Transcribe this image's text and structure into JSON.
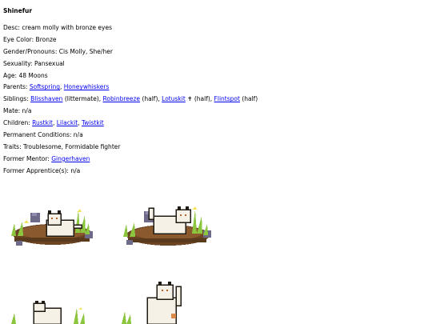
{
  "name": "Shinefur",
  "fields": {
    "desc": {
      "label": "Desc:",
      "value": "cream molly with bronze eyes"
    },
    "eye_color": {
      "label": "Eye Color:",
      "value": "Bronze"
    },
    "gender": {
      "label": "Gender/Pronouns:",
      "value": "Cis Molly, She/her"
    },
    "sexuality": {
      "label": "Sexuality:",
      "value": "Pansexual"
    },
    "age": {
      "label": "Age:",
      "value": "48 Moons"
    },
    "parents": {
      "label": "Parents:",
      "links": [
        "Softspring",
        "Honeywhiskers"
      ]
    },
    "siblings": {
      "label": "Siblings:",
      "items": [
        {
          "link": "Blisshaven",
          "note": "(littermate)"
        },
        {
          "link": "Robinbreeze",
          "note": "(half)"
        },
        {
          "link": "Lotuskit",
          "note": "✝ (half)"
        },
        {
          "link": "Flintspot",
          "note": "(half)"
        }
      ]
    },
    "mate": {
      "label": "Mate:",
      "value": "n/a"
    },
    "children": {
      "label": "Children:",
      "links": [
        "Rustkit",
        "Lilackit",
        "Twistkit"
      ]
    },
    "conditions": {
      "label": "Permanent Conditions:",
      "value": "n/a"
    },
    "traits": {
      "label": "Traits:",
      "value": "Troublesome, Formidable fighter"
    },
    "former_mentor": {
      "label": "Former Mentor:",
      "link": "Gingerhaven"
    },
    "former_apprentice": {
      "label": "Former Apprentice(s):",
      "value": "n/a"
    }
  },
  "sep": {
    "comma": ", ",
    "space": " "
  },
  "colors": {
    "link": "#0000ee",
    "fur": "#f6f1e6",
    "dirt": "#6b4423",
    "grass": "#8cc63f",
    "rock": "#6d6a8a"
  }
}
